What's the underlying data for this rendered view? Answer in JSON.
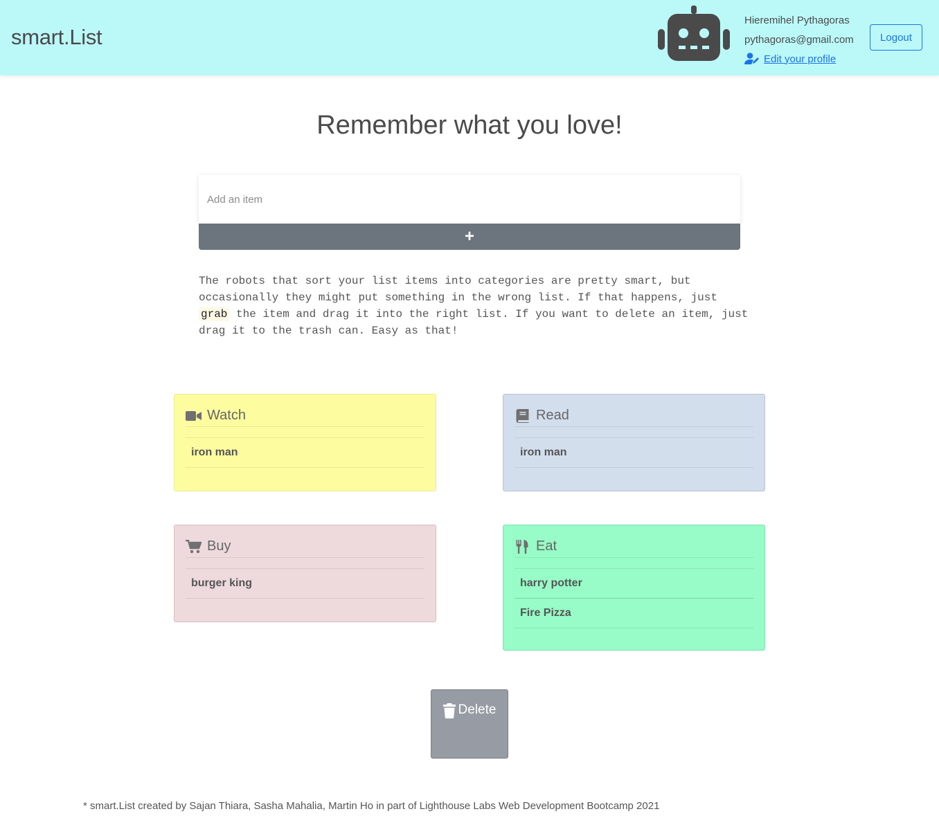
{
  "nav": {
    "brand": "smart.List",
    "user_name": "Hieremihel Pythagoras",
    "user_email": "pythagoras@gmail.com",
    "edit_profile": "Edit your profile",
    "logout": "Logout"
  },
  "hero": {
    "title": "Remember what you love!"
  },
  "add_item": {
    "placeholder": "Add an item",
    "button": "+"
  },
  "info": {
    "before": "The robots that sort your list items into categories are pretty smart, but occasionally they might put something in the wrong list. If that happens, just ",
    "code": "grab",
    "after": " the item and drag it into the right list. If you want to delete an item, just drag it to the trash can. Easy as that!"
  },
  "categories": {
    "watch": {
      "title": "Watch",
      "icon": "video-camera-icon",
      "items": [
        "iron man"
      ]
    },
    "read": {
      "title": "Read",
      "icon": "book-icon",
      "items": [
        "iron man"
      ]
    },
    "buy": {
      "title": "Buy",
      "icon": "shopping-cart-icon",
      "items": [
        "burger king"
      ]
    },
    "eat": {
      "title": "Eat",
      "icon": "utensils-icon",
      "items": [
        "harry potter",
        "Fire Pizza"
      ]
    }
  },
  "trash": {
    "label": "Delete",
    "icon": "trash-icon"
  },
  "footer": {
    "text": "* smart.List created by Sajan Thiara, Sasha Mahalia, Martin Ho in part of Lighthouse Labs Web Development Bootcamp 2021"
  },
  "colors": {
    "navbar": "#bbf9f9",
    "accent": "#1a73e8",
    "watch": "#fdfda0",
    "read": "#d3deed",
    "buy": "#eedadd",
    "eat": "#97fcc7",
    "trash": "#979ca4"
  }
}
